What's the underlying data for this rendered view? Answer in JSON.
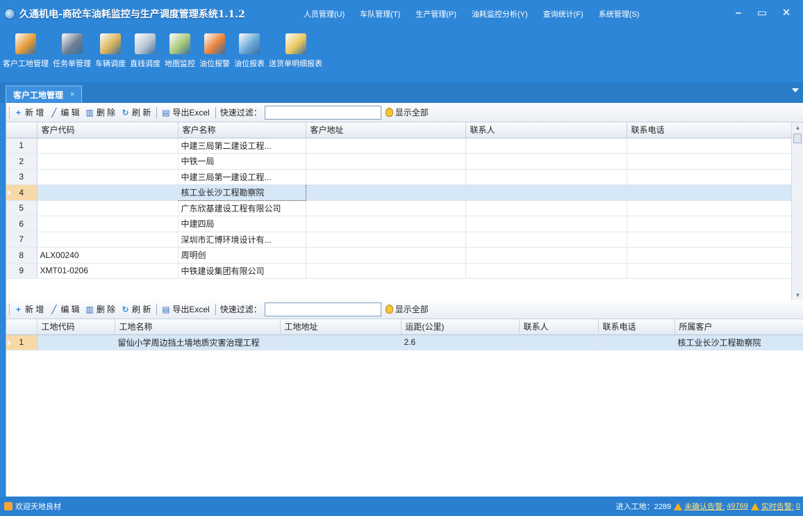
{
  "window": {
    "title": "久通机电-商砼车油耗监控与生产调度管理系统1.1.2",
    "menu": [
      "人员管理(U)",
      "车队管理(T)",
      "生产管理(P)",
      "油耗监控分析(Y)",
      "查询统计(F)",
      "系统管理(S)"
    ],
    "controls": {
      "minimize": "–",
      "maximize": "▭",
      "close": "✕"
    }
  },
  "ribbon": [
    {
      "label": "客户工地管理",
      "icon": "customer-site-icon",
      "color": "#e39a35"
    },
    {
      "label": "任务单管理",
      "icon": "task-order-icon",
      "color": "#6f7f93"
    },
    {
      "label": "车辆调度",
      "icon": "vehicle-dispatch-icon",
      "color": "#d9b45a"
    },
    {
      "label": "直线调度",
      "icon": "line-dispatch-icon",
      "color": "#b9c6d3"
    },
    {
      "label": "地图监控",
      "icon": "map-monitor-icon",
      "color": "#a8c878"
    },
    {
      "label": "油位报警",
      "icon": "fuel-alarm-icon",
      "color": "#e8823a"
    },
    {
      "label": "油位报表",
      "icon": "fuel-report-icon",
      "color": "#6aa9d8"
    },
    {
      "label": "送货单明细报表",
      "icon": "delivery-report-icon",
      "color": "#e8c75a"
    }
  ],
  "tab": {
    "label": "客户工地管理",
    "close": "×"
  },
  "toolbar": {
    "add": "新 增",
    "edit": "编 辑",
    "delete": "删 除",
    "refresh": "刷 新",
    "export": "导出Excel",
    "filter_label": "快速过滤：",
    "filter_value": "",
    "show_all": "显示全部"
  },
  "customers": {
    "headers": [
      "客户代码",
      "客户名称",
      "客户地址",
      "联系人",
      "联系电话"
    ],
    "rows": [
      {
        "n": "1",
        "code": "",
        "name": "中建三局第二建设工程...",
        "addr": "",
        "contact": "",
        "phone": ""
      },
      {
        "n": "2",
        "code": "",
        "name": "中铁一局",
        "addr": "",
        "contact": "",
        "phone": ""
      },
      {
        "n": "3",
        "code": "",
        "name": "中建三局第一建设工程...",
        "addr": "",
        "contact": "",
        "phone": ""
      },
      {
        "n": "4",
        "code": "",
        "name": "核工业长沙工程勘察院",
        "addr": "",
        "contact": "",
        "phone": ""
      },
      {
        "n": "5",
        "code": "",
        "name": "广东欣基建设工程有限公司",
        "addr": "",
        "contact": "",
        "phone": ""
      },
      {
        "n": "6",
        "code": "",
        "name": "中建四局",
        "addr": "",
        "contact": "",
        "phone": ""
      },
      {
        "n": "7",
        "code": "",
        "name": "深圳市汇博环境设计有...",
        "addr": "",
        "contact": "",
        "phone": ""
      },
      {
        "n": "8",
        "code": "ALX00240",
        "name": "周明创",
        "addr": "",
        "contact": "",
        "phone": ""
      },
      {
        "n": "9",
        "code": "XMT01-0206",
        "name": "中铁建设集团有限公司",
        "addr": "",
        "contact": "",
        "phone": ""
      }
    ],
    "selected_row": "4"
  },
  "sites": {
    "headers": [
      "工地代码",
      "工地名称",
      "工地地址",
      "运距(公里)",
      "联系人",
      "联系电话",
      "所属客户"
    ],
    "rows": [
      {
        "n": "1",
        "code": "",
        "name": "留仙小学周边挡土墙地质灾害治理工程",
        "addr": "",
        "distance": "2.6",
        "contact": "",
        "phone": "",
        "customer": "核工业长沙工程勘察院"
      }
    ]
  },
  "status": {
    "welcome": "欢迎天地良材",
    "sites_label": "进入工地：2289",
    "unconfirmed_label": "未确认告警:",
    "unconfirmed_count": "49769",
    "realtime_label": "实时告警:",
    "realtime_count": "0"
  }
}
